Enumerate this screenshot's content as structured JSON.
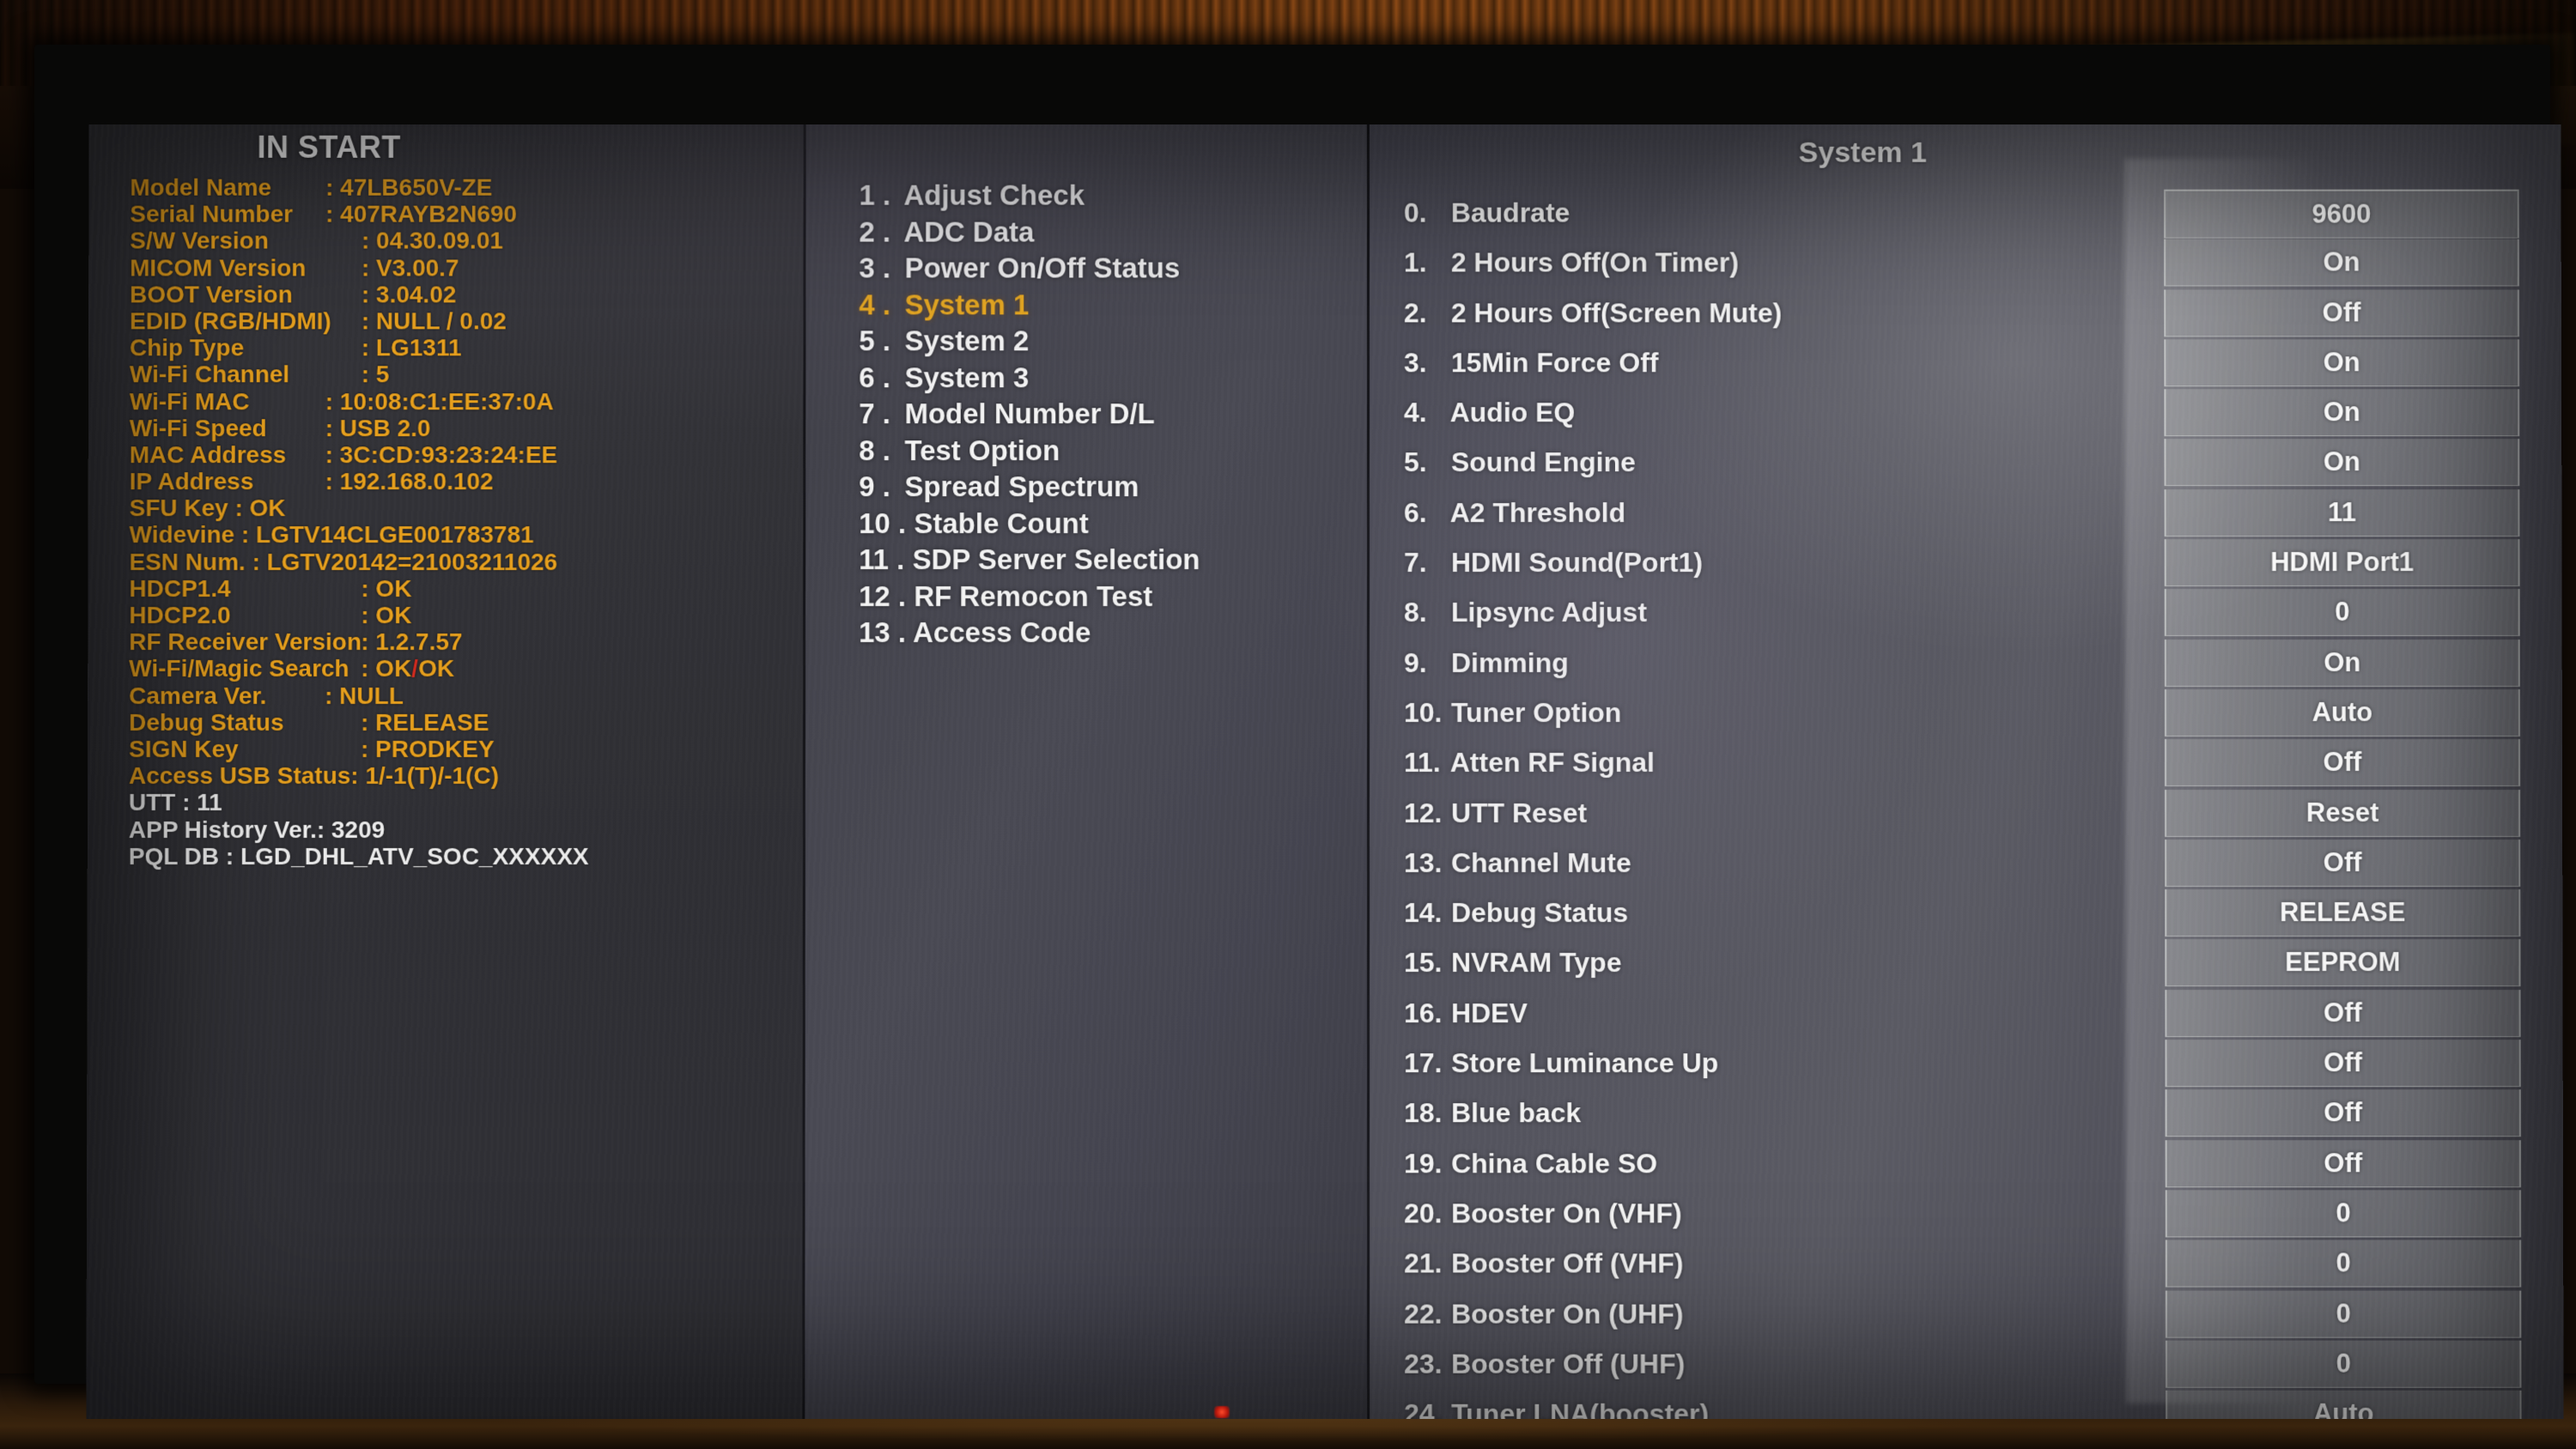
{
  "screen": {
    "left_panel": {
      "heading": "IN START",
      "rows": [
        {
          "key": "Model Name",
          "value": ": 47LB650V-ZE",
          "style": "pair"
        },
        {
          "key": "Serial Number",
          "value": ": 407RAYB2N690",
          "style": "pair"
        },
        {
          "key": "S/W Version",
          "value": ": 04.30.09.01",
          "style": "pair-wide"
        },
        {
          "key": "MICOM Version",
          "value": ": V3.00.7",
          "style": "pair-wide"
        },
        {
          "key": "BOOT Version",
          "value": ": 3.04.02",
          "style": "pair-wide"
        },
        {
          "key": "EDID (RGB/HDMI)",
          "value": ": NULL / 0.02",
          "style": "pair-wide"
        },
        {
          "key": "Chip Type",
          "value": ": LG1311",
          "style": "pair-wide"
        },
        {
          "key": "Wi-Fi Channel",
          "value": ": 5",
          "style": "pair-wide"
        },
        {
          "key": "Wi-Fi MAC",
          "value": ": 10:08:C1:EE:37:0A",
          "style": "pair"
        },
        {
          "key": "Wi-Fi Speed",
          "value": ": USB 2.0",
          "style": "pair"
        },
        {
          "key": "MAC Address",
          "value": ": 3C:CD:93:23:24:EE",
          "style": "pair"
        },
        {
          "key": "IP Address",
          "value": ": 192.168.0.102",
          "style": "pair"
        },
        {
          "key": "SFU Key : OK",
          "value": "",
          "style": "free"
        },
        {
          "key": "Widevine : LGTV14CLGE001783781",
          "value": "",
          "style": "free"
        },
        {
          "key": "ESN Num. : LGTV20142=21003211026",
          "value": "",
          "style": "free"
        },
        {
          "key": "HDCP1.4",
          "value": ": OK",
          "style": "pair-wide"
        },
        {
          "key": "HDCP2.0",
          "value": ": OK",
          "style": "pair-wide"
        },
        {
          "key": "RF Receiver Version",
          "value": ": 1.2.7.57",
          "style": "pair-wide"
        },
        {
          "key": "Wi-Fi/Magic Search",
          "value": ": OK/OK",
          "style": "pair-wide",
          "red_slash": true
        },
        {
          "key": "Camera Ver.",
          "value": ": NULL",
          "style": "pair"
        },
        {
          "key": "Debug Status",
          "value": ": RELEASE",
          "style": "pair-wide"
        },
        {
          "key": "SIGN Key",
          "value": ": PRODKEY",
          "style": "pair-wide"
        },
        {
          "key": "Access USB Status: 1/-1(T)/-1(C)",
          "value": "",
          "style": "free"
        },
        {
          "key": "UTT : 11",
          "value": "",
          "style": "free",
          "white": true
        },
        {
          "key": "APP History Ver.: 3209",
          "value": "",
          "style": "free",
          "white": true
        },
        {
          "key": "PQL DB : LGD_DHL_ATV_SOC_XXXXXX",
          "value": "",
          "style": "free",
          "white": true
        }
      ]
    },
    "middle_panel": {
      "items": [
        {
          "num": "1 .",
          "label": "Adjust Check",
          "selected": false
        },
        {
          "num": "2 .",
          "label": "ADC Data",
          "selected": false
        },
        {
          "num": "3 .",
          "label": "Power On/Off Status",
          "selected": false
        },
        {
          "num": "4 .",
          "label": "System 1",
          "selected": true
        },
        {
          "num": "5 .",
          "label": "System 2",
          "selected": false
        },
        {
          "num": "6 .",
          "label": "System 3",
          "selected": false
        },
        {
          "num": "7 .",
          "label": "Model Number D/L",
          "selected": false
        },
        {
          "num": "8 .",
          "label": "Test Option",
          "selected": false
        },
        {
          "num": "9 .",
          "label": "Spread Spectrum",
          "selected": false
        },
        {
          "num": "10 .",
          "label": "Stable Count",
          "selected": false
        },
        {
          "num": "11 .",
          "label": "SDP Server Selection",
          "selected": false
        },
        {
          "num": "12 .",
          "label": "RF Remocon Test",
          "selected": false
        },
        {
          "num": "13 .",
          "label": "Access Code",
          "selected": false
        }
      ]
    },
    "right_panel": {
      "title": "System 1",
      "rows": [
        {
          "num": "0.",
          "label": "Baudrate",
          "value": "9600"
        },
        {
          "num": "1.",
          "label": "2 Hours Off(On Timer)",
          "value": "On"
        },
        {
          "num": "2.",
          "label": "2 Hours Off(Screen Mute)",
          "value": "Off"
        },
        {
          "num": "3.",
          "label": "15Min Force Off",
          "value": "On"
        },
        {
          "num": "4.",
          "label": "Audio EQ",
          "value": "On"
        },
        {
          "num": "5.",
          "label": "Sound Engine",
          "value": "On"
        },
        {
          "num": "6.",
          "label": "A2 Threshold",
          "value": "11"
        },
        {
          "num": "7.",
          "label": "HDMI Sound(Port1)",
          "value": "HDMI Port1"
        },
        {
          "num": "8.",
          "label": "Lipsync Adjust",
          "value": "0"
        },
        {
          "num": "9.",
          "label": "Dimming",
          "value": "On"
        },
        {
          "num": "10.",
          "label": "Tuner Option",
          "value": "Auto"
        },
        {
          "num": "11.",
          "label": "Atten RF Signal",
          "value": "Off"
        },
        {
          "num": "12.",
          "label": "UTT Reset",
          "value": "Reset"
        },
        {
          "num": "13.",
          "label": "Channel Mute",
          "value": "Off"
        },
        {
          "num": "14.",
          "label": "Debug Status",
          "value": "RELEASE"
        },
        {
          "num": "15.",
          "label": "NVRAM Type",
          "value": "EEPROM"
        },
        {
          "num": "16.",
          "label": "HDEV",
          "value": "Off"
        },
        {
          "num": "17.",
          "label": "Store Luminance Up",
          "value": "Off"
        },
        {
          "num": "18.",
          "label": "Blue back",
          "value": "Off"
        },
        {
          "num": "19.",
          "label": "China Cable SO",
          "value": "Off"
        },
        {
          "num": "20.",
          "label": "Booster On (VHF)",
          "value": "0"
        },
        {
          "num": "21.",
          "label": "Booster Off (VHF)",
          "value": "0"
        },
        {
          "num": "22.",
          "label": "Booster On (UHF)",
          "value": "0"
        },
        {
          "num": "23.",
          "label": "Booster Off (UHF)",
          "value": "0"
        },
        {
          "num": "24.",
          "label": "Tuner LNA(booster)",
          "value": "Auto"
        }
      ]
    }
  },
  "colors": {
    "amber_text": "#e8a01c",
    "white_text": "#f4f4f4",
    "selected_item": "#e9a81b",
    "red_slash": "#d42a1e",
    "screen_bg": "#4a4a54",
    "value_box_bg": "#bec0be"
  }
}
